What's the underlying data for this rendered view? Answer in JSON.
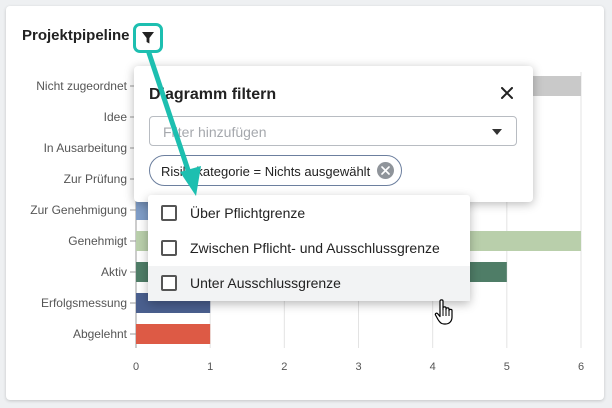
{
  "card": {
    "title": "Projektpipeline"
  },
  "filter_button": {
    "icon": "funnel-icon",
    "accent_color": "#1dbfb0"
  },
  "chart_data": {
    "type": "bar",
    "orientation": "horizontal",
    "categories": [
      "Nicht zugeordnet",
      "Idee",
      "In Ausarbeitung",
      "Zur Prüfung",
      "Zur Genehmigung",
      "Genehmigt",
      "Aktiv",
      "Erfolgsmessung",
      "Abgelehnt"
    ],
    "values": [
      6,
      0,
      0,
      0,
      1,
      6,
      5,
      1,
      1
    ],
    "colors": [
      "#c9c9c9",
      "#c9c9c9",
      "#c9c9c9",
      "#c9c9c9",
      "#7f9dc7",
      "#b9cfab",
      "#4f7d67",
      "#4a5f8e",
      "#dd5a45"
    ],
    "x_ticks": [
      "0",
      "1",
      "2",
      "3",
      "4",
      "5",
      "6"
    ],
    "xlim": [
      0,
      6
    ],
    "grid": true,
    "title": "Projektpipeline",
    "xlabel": "",
    "ylabel": ""
  },
  "filter_panel": {
    "title": "Diagramm filtern",
    "close_icon": "close-icon",
    "select": {
      "placeholder": "Filter hinzufügen"
    },
    "chip": {
      "label": "Risikokategorie = Nichts ausgewählt",
      "remove_icon": "remove-chip-icon"
    }
  },
  "dropdown": {
    "options": [
      {
        "label": "Über Pflichtgrenze",
        "checked": false
      },
      {
        "label": "Zwischen Pflicht- und Ausschlussgrenze",
        "checked": false
      },
      {
        "label": "Unter Ausschlussgrenze",
        "checked": false
      }
    ]
  },
  "annotation": {
    "arrow_color": "#1dbfb0"
  },
  "cursor": {
    "icon": "hand-pointer-icon"
  }
}
